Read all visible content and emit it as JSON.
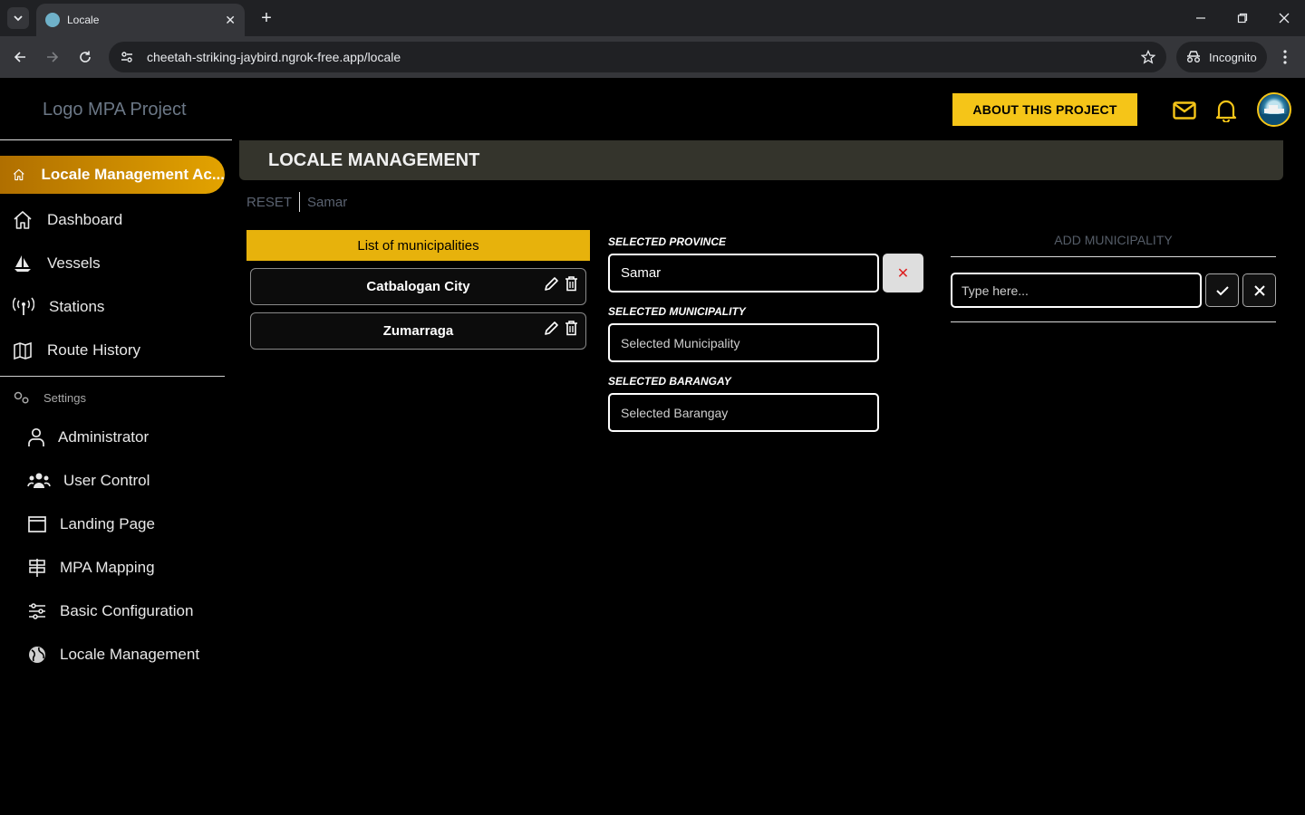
{
  "browser": {
    "tab_title": "Locale",
    "url": "cheetah-striking-jaybird.ngrok-free.app/locale",
    "incognito_label": "Incognito"
  },
  "header": {
    "logo": "Logo MPA Project",
    "about_button": "ABOUT THIS PROJECT"
  },
  "sidebar": {
    "active_item": "Locale Management Ac...",
    "items": [
      "Dashboard",
      "Vessels",
      "Stations",
      "Route History"
    ],
    "settings_label": "Settings",
    "sub_items": [
      "Administrator",
      "User Control",
      "Landing Page",
      "MPA Mapping",
      "Basic Configuration",
      "Locale Management"
    ]
  },
  "main": {
    "banner_title": "LOCALE MANAGEMENT",
    "breadcrumb": {
      "reset": "RESET",
      "current": "Samar"
    },
    "list": {
      "header": "List of municipalities",
      "items": [
        "Catbalogan City",
        "Zumarraga"
      ]
    },
    "province": {
      "label": "SELECTED PROVINCE",
      "value": "Samar"
    },
    "municipality": {
      "label": "SELECTED MUNICIPALITY",
      "placeholder": "Selected Municipality"
    },
    "barangay": {
      "label": "SELECTED BARANGAY",
      "placeholder": "Selected Barangay"
    },
    "add": {
      "header": "ADD MUNICIPALITY",
      "placeholder": "Type here..."
    }
  },
  "colors": {
    "accent": "#f5c518",
    "active_gradient_start": "#b06f00",
    "banner": "#34342c"
  }
}
